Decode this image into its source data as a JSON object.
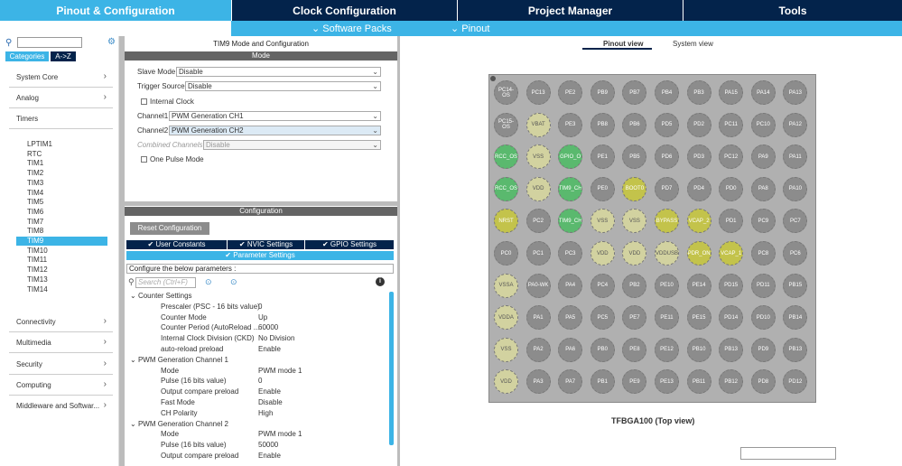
{
  "top_tabs": [
    "Pinout & Configuration",
    "Clock Configuration",
    "Project Manager",
    "Tools"
  ],
  "sub_menu": {
    "software_packs": "Software Packs",
    "pinout": "Pinout"
  },
  "left": {
    "cat_tabs": [
      "Categories",
      "A->Z"
    ],
    "categories": [
      "System Core",
      "Analog",
      "Timers",
      "Connectivity",
      "Multimedia",
      "Security",
      "Computing",
      "Middleware and Softwar..."
    ],
    "timers": [
      "LPTIM1",
      "RTC",
      "TIM1",
      "TIM2",
      "TIM3",
      "TIM4",
      "TIM5",
      "TIM6",
      "TIM7",
      "TIM8",
      "TIM9",
      "TIM10",
      "TIM11",
      "TIM12",
      "TIM13",
      "TIM14"
    ]
  },
  "mid": {
    "title": "TIM9 Mode and Configuration",
    "mode_header": "Mode",
    "slave_mode": {
      "label": "Slave Mode",
      "value": "Disable"
    },
    "trigger_source": {
      "label": "Trigger Source",
      "value": "Disable"
    },
    "internal_clock": "Internal Clock",
    "channel1": {
      "label": "Channel1",
      "value": "PWM Generation CH1"
    },
    "channel2": {
      "label": "Channel2",
      "value": "PWM Generation CH2"
    },
    "combined": {
      "label": "Combined Channels",
      "value": "Disable"
    },
    "one_pulse": "One Pulse Mode",
    "config_header": "Configuration",
    "reset_btn": "Reset Configuration",
    "tabs": [
      "User Constants",
      "NVIC Settings",
      "GPIO Settings"
    ],
    "param_tab": "Parameter Settings",
    "configure_text": "Configure the below parameters :",
    "search_placeholder": "Search (Ctrl+F)",
    "groups": [
      {
        "name": "Counter Settings",
        "rows": [
          [
            "Prescaler (PSC - 16 bits value)",
            "0"
          ],
          [
            "Counter Mode",
            "Up"
          ],
          [
            "Counter Period (AutoReload ...",
            "60000"
          ],
          [
            "Internal Clock Division (CKD)",
            "No Division"
          ],
          [
            "auto-reload preload",
            "Enable"
          ]
        ]
      },
      {
        "name": "PWM Generation Channel 1",
        "rows": [
          [
            "Mode",
            "PWM mode 1"
          ],
          [
            "Pulse (16 bits value)",
            "0"
          ],
          [
            "Output compare preload",
            "Enable"
          ],
          [
            "Fast Mode",
            "Disable"
          ],
          [
            "CH Polarity",
            "High"
          ]
        ]
      },
      {
        "name": "PWM Generation Channel 2",
        "rows": [
          [
            "Mode",
            "PWM mode 1"
          ],
          [
            "Pulse (16 bits value)",
            "50000"
          ],
          [
            "Output compare preload",
            "Enable"
          ]
        ]
      }
    ]
  },
  "right": {
    "view_tabs": [
      "Pinout view",
      "System view"
    ],
    "package": "TFBGA100 (Top view)",
    "pins": [
      [
        "PC14-OS",
        "PC13",
        "PE2",
        "PB9",
        "PB7",
        "PB4",
        "PB3",
        "PA15",
        "PA14",
        "PA13"
      ],
      [
        "PC15-OS",
        "VBAT",
        "PE3",
        "PB8",
        "PB6",
        "PD5",
        "PD2",
        "PC11",
        "PC10",
        "PA12"
      ],
      [
        "RCC_OS",
        "VSS",
        "GPIO_O",
        "PE1",
        "PB5",
        "PD6",
        "PD3",
        "PC12",
        "PA9",
        "PA11"
      ],
      [
        "RCC_OS",
        "VDD",
        "TIM9_CH",
        "PE0",
        "BOOT0",
        "PD7",
        "PD4",
        "PD0",
        "PA8",
        "PA10"
      ],
      [
        "NRST",
        "PC2",
        "TIM9_CH",
        "VSS",
        "VSS",
        "BYPASS",
        "VCAP_2",
        "PD1",
        "PC9",
        "PC7"
      ],
      [
        "PC0",
        "PC1",
        "PC3",
        "VDD",
        "VDD",
        "VDDUSB",
        "PDR_ON",
        "VCAP_1",
        "PC8",
        "PC6"
      ],
      [
        "VSSA",
        "PA0-WK",
        "PA4",
        "PC4",
        "PB2",
        "PE10",
        "PE14",
        "PD15",
        "PD11",
        "PB15"
      ],
      [
        "VDDA",
        "PA1",
        "PA5",
        "PC5",
        "PE7",
        "PE11",
        "PE15",
        "PD14",
        "PD10",
        "PB14"
      ],
      [
        "VSS",
        "PA2",
        "PA6",
        "PB0",
        "PE8",
        "PE12",
        "PB10",
        "PB13",
        "PD9",
        "PB13"
      ],
      [
        "VDD",
        "PA3",
        "PA7",
        "PB1",
        "PE9",
        "PE13",
        "PB11",
        "PB12",
        "PD8",
        "PD12"
      ]
    ]
  }
}
